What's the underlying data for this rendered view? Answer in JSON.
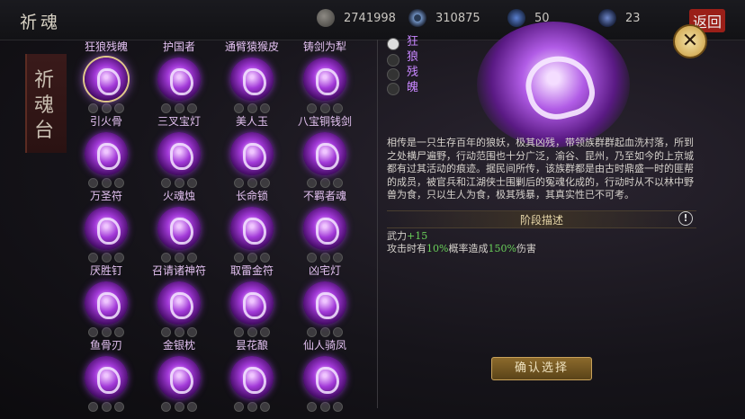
{
  "header": {
    "title": "祈魂",
    "resources": [
      {
        "icon": "coin-icon",
        "value": "2741998"
      },
      {
        "icon": "swirl-icon",
        "value": "310875"
      },
      {
        "icon": "blue-flame-icon",
        "value": "50"
      },
      {
        "icon": "lotus-icon",
        "value": "23"
      }
    ],
    "back_label": "返回"
  },
  "sidebar": {
    "banner_text": "祈魂台"
  },
  "souls": [
    {
      "name": "狂狼残魄",
      "selected": true
    },
    {
      "name": "护国者"
    },
    {
      "name": "通臂猿猴皮"
    },
    {
      "name": "铸剑为犁"
    },
    {
      "name": "引火骨"
    },
    {
      "name": "三叉宝灯"
    },
    {
      "name": "美人玉"
    },
    {
      "name": "八宝铜钱剑"
    },
    {
      "name": "万圣符"
    },
    {
      "name": "火魂烛"
    },
    {
      "name": "长命锁"
    },
    {
      "name": "不羁者魂"
    },
    {
      "name": "厌胜钉"
    },
    {
      "name": "召请诸神符"
    },
    {
      "name": "取雷金符"
    },
    {
      "name": "凶宅灯"
    },
    {
      "name": "鱼骨刃"
    },
    {
      "name": "金银枕"
    },
    {
      "name": "昙花酿"
    },
    {
      "name": "仙人骑凤"
    }
  ],
  "detail": {
    "name": "狂狼残魄",
    "description": "相传是一只生存百年的狼妖，极其凶残，带领族群群起血洗村落，所到之处横尸遍野，行动范围也十分广泛，渝谷、昆州，乃至如今的上京城都有过其活动的痕迹。据民间所传，该族群都是由古时鼎盛一时的匪帮的成员，被官兵和江湖侠士围剿后的冤魂化成的，行动时从不以林中野兽为食，只以生人为食，极其残暴，其真实性已不可考。",
    "section_title": "阶段描述",
    "stat_line1_prefix": "武力",
    "stat_line1_value": "+15",
    "stat_line2_a": "攻击时有",
    "stat_line2_b": "10%",
    "stat_line2_c": "概率造成",
    "stat_line2_d": "150%",
    "stat_line2_e": "伤害"
  },
  "actions": {
    "confirm_label": "确认选择"
  },
  "colors": {
    "accent": "#b15ce6",
    "gold": "#c9a25a",
    "highlight_green": "#6ad15a"
  }
}
